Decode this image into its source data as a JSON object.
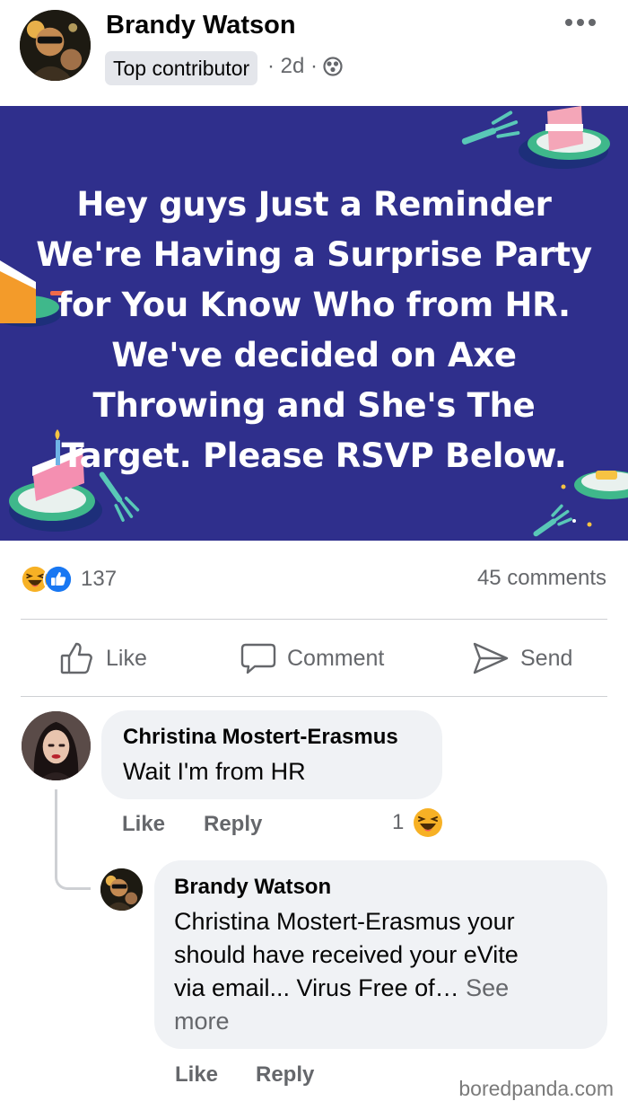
{
  "post": {
    "author": "Brandy Watson",
    "badge": "Top contributor",
    "time": "· 2d ·",
    "icons": {
      "menu": "more-dots-icon",
      "audience": "globe-icon",
      "avatar": "profile-photo"
    }
  },
  "banner": {
    "text": "Hey guys Just a Reminder We're Having a Surprise Party for You Know Who from HR. We've decided on Axe Throwing and She's The Target. Please RSVP Below.",
    "background": "#2f2f8c",
    "decorations": [
      "cake-slice",
      "fork",
      "plate"
    ]
  },
  "reactions": {
    "icons": [
      "haha-react-icon",
      "like-react-icon"
    ],
    "count": "137",
    "comments": "45 comments"
  },
  "actions": [
    {
      "label": "Like",
      "icon": "thumbs-up-icon"
    },
    {
      "label": "Comment",
      "icon": "speech-bubble-icon"
    },
    {
      "label": "Send",
      "icon": "send-arrow-icon"
    }
  ],
  "comments": [
    {
      "author": "Christina Mostert-Erasmus",
      "text": "Wait I'm from HR",
      "like": "Like",
      "reply": "Reply",
      "reaction_count": "1",
      "reaction_icon": "haha-react-icon"
    },
    {
      "author": "Brandy Watson",
      "text_line1": "Christina Mostert-Erasmus your",
      "text_line2": "should have received your eVite",
      "text_line3": "via email... Virus Free of…",
      "see_more_a": "See",
      "see_more_b": "more",
      "like": "Like",
      "reply": "Reply"
    }
  ],
  "watermark": "boredpanda.com",
  "colors": {
    "secondary_text": "#65676b",
    "bubble": "#f0f2f5",
    "like_blue": "#1877f2",
    "haha_yellow": "#f7b125"
  }
}
